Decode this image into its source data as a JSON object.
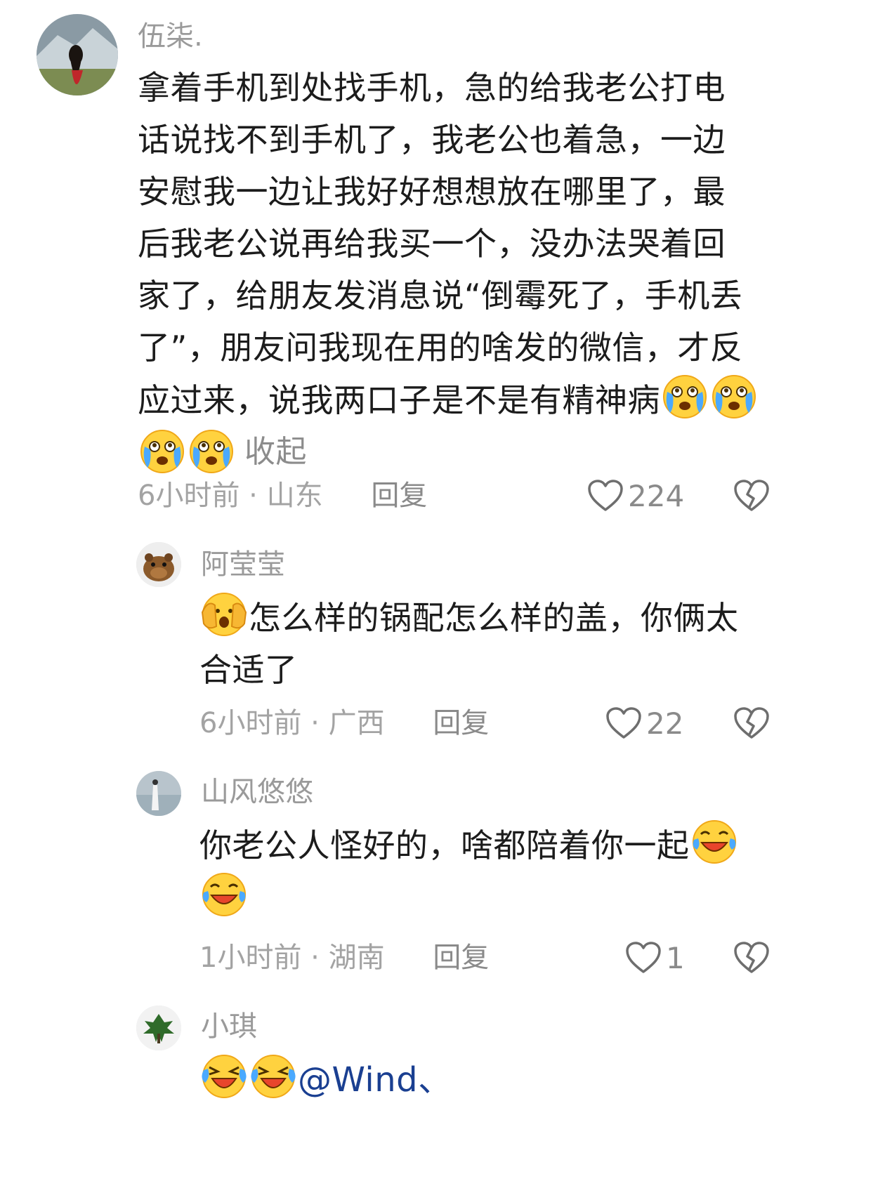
{
  "comments": [
    {
      "username": "伍柒.",
      "text_lines": [
        "拿着手机到处找手机，急的给我老公打电",
        "话说找不到手机了，我老公也着急，一边",
        "安慰我一边让我好好想想放在哪里了，最",
        "后我老公说再给我买一个，没办法哭着回",
        "家了，给朋友发消息说“倒霉死了，手机丢",
        "了”，朋友问我现在用的啥发的微信，才反",
        "应过来，说我两口子是不是有精神病"
      ],
      "collapse_label": "收起",
      "time_location": "6小时前 · 山东",
      "reply_label": "回复",
      "likes": "224",
      "emoji_icons": [
        "crying-emoji",
        "crying-emoji",
        "crying-emoji",
        "crying-emoji"
      ]
    },
    {
      "username": "阿莹莹",
      "text_lines": [
        "怎么样的锅配怎么样的盖，你俩太",
        "合适了"
      ],
      "time_location": "6小时前 · 广西",
      "reply_label": "回复",
      "likes": "22",
      "emoji_icons": [
        "face-in-hands-emoji"
      ]
    },
    {
      "username": "山风悠悠",
      "text_lines": [
        "你老公人怪好的，啥都陪着你一起"
      ],
      "time_location": "1小时前 · 湖南",
      "reply_label": "回复",
      "likes": "1",
      "emoji_icons": [
        "tears-of-joy-emoji",
        "tears-of-joy-emoji"
      ]
    },
    {
      "username": "小琪",
      "mention": "@Wind、",
      "emoji_icons": [
        "laugh-cry-emoji",
        "laugh-cry-emoji"
      ]
    }
  ],
  "colors": {
    "username": "#9a9a9a",
    "meta": "#a3a3a3",
    "mention": "#1a3f91",
    "text": "#1c1c1c"
  },
  "icons": {
    "like": "heart-outline-icon",
    "dislike": "broken-heart-icon"
  }
}
